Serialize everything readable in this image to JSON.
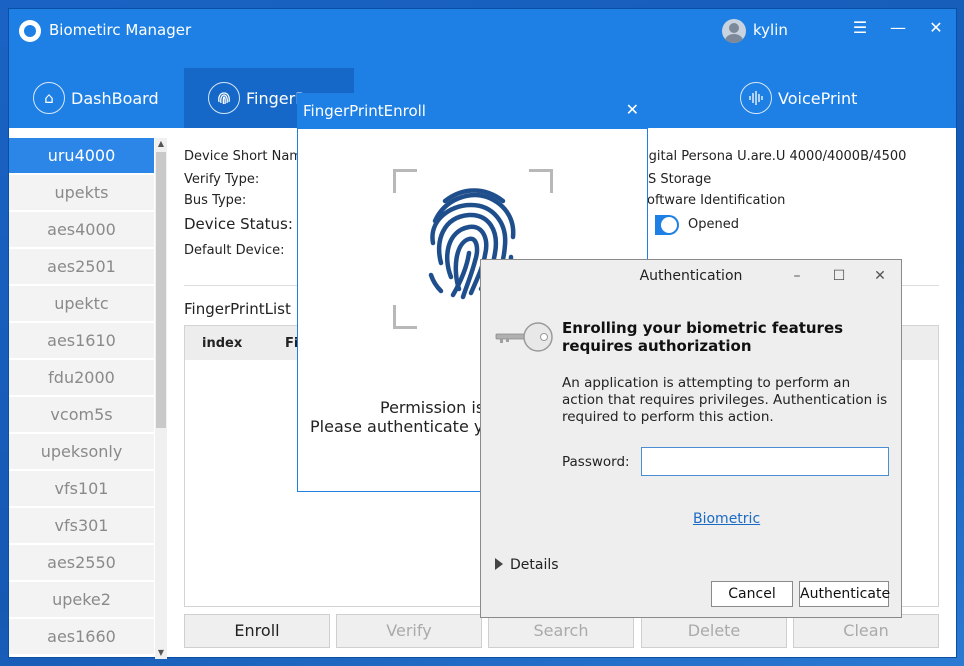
{
  "app": {
    "title": "Biometirc Manager",
    "user": "kylin"
  },
  "tabs": [
    {
      "label": "DashBoard",
      "icon": "home-icon"
    },
    {
      "label": "FingerPr",
      "icon": "fingerprint-icon"
    },
    {
      "label": "VoicePrint",
      "icon": "voiceprint-icon"
    }
  ],
  "sidebar": {
    "items": [
      "uru4000",
      "upekts",
      "aes4000",
      "aes2501",
      "upektc",
      "aes1610",
      "fdu2000",
      "vcom5s",
      "upeksonly",
      "vfs101",
      "vfs301",
      "aes2550",
      "upeke2",
      "aes1660"
    ],
    "selected": "uru4000"
  },
  "device_info": {
    "short_name_label": "Device Short Nam",
    "short_name_value": "igital Persona U.are.U 4000/4000B/4500",
    "verify_type_label": "Verify Type:",
    "verify_type_value": "S Storage",
    "bus_type_label": "Bus Type:",
    "bus_type_value": "oftware Identification",
    "status_label": "Device Status:",
    "status_value": "Opened",
    "default_device_label": "Default Device:"
  },
  "fingerprint_list": {
    "title": "FingerPrintList",
    "columns": [
      "index",
      "Fi"
    ]
  },
  "actions": {
    "enroll": "Enroll",
    "verify": "Verify",
    "search": "Search",
    "delete": "Delete",
    "clean": "Clean"
  },
  "enroll_dialog": {
    "title": "FingerPrintEnroll",
    "message_line1": "Permission is",
    "message_line2": "Please authenticate y"
  },
  "auth_dialog": {
    "title": "Authentication",
    "heading": "Enrolling your biometric features requires authorization",
    "body": "An application is attempting to perform an action that requires privileges. Authentication is required to perform this action.",
    "password_label": "Password:",
    "password_value": "",
    "biometric_link": "Biometric",
    "details_label": "Details",
    "cancel": "Cancel",
    "authenticate": "Authenticate"
  },
  "colors": {
    "brand_blue": "#1e80e4",
    "selected_item": "#2b86e8",
    "fingerprint_blue": "#1f4e8c"
  }
}
